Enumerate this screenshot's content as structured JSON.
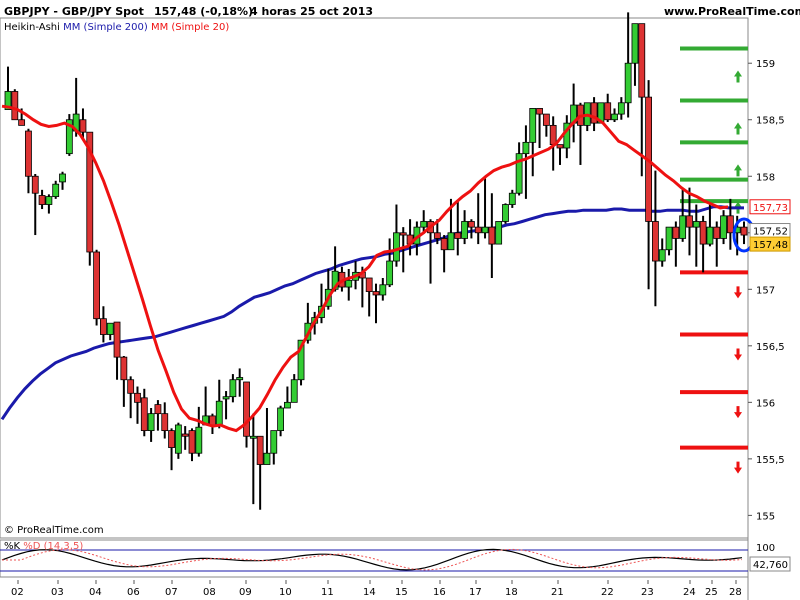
{
  "header": {
    "instrument": "GBPJPY - GBP/JPY Spot",
    "quote": "157,48 (-0,18%)",
    "period": "4 horas  25 oct 2013",
    "site": "www.ProRealTime.com"
  },
  "legend": {
    "chart_style": "Heikin-Ashi",
    "ma200": "MM (Simple 200)",
    "ma20": "MM (Simple 20)"
  },
  "watermark": "© ProRealTime.com",
  "price_labels": {
    "ma20_value": "157,73",
    "ma200_value": "157,52",
    "last_price": "157,48"
  },
  "stoch": {
    "label_k": "%K",
    "label_d": "%D (14,3,5)",
    "level_high": "100",
    "level_value": "42,760"
  },
  "colors": {
    "bull": "#33cc33",
    "bear": "#dd3333",
    "ma20": "#ee1111",
    "ma200": "#1a1aaa",
    "resistance": "#33aa33",
    "support": "#ee1111",
    "label_gold": "#ffcc33"
  },
  "chart_data": {
    "type": "candlestick",
    "title": "GBPJPY - GBP/JPY Spot",
    "ylim": [
      154.8,
      159.4
    ],
    "y_ticks": [
      155,
      155.5,
      156,
      156.5,
      157,
      157.5,
      158,
      158.5,
      159
    ],
    "y_tick_labels": [
      "155",
      "155,5",
      "156",
      "156,5",
      "157",
      "157,5",
      "158",
      "158,5",
      "159"
    ],
    "x_day_labels": [
      "02",
      "03",
      "04",
      "06",
      "07",
      "08",
      "09",
      "10",
      "11",
      "14",
      "15",
      "16",
      "17",
      "18",
      "21",
      "22",
      "23",
      "24",
      "25",
      "28"
    ],
    "sma200": [
      155.85,
      155.95,
      156.04,
      156.12,
      156.19,
      156.25,
      156.3,
      156.35,
      156.38,
      156.41,
      156.43,
      156.45,
      156.48,
      156.5,
      156.52,
      156.53,
      156.54,
      156.55,
      156.56,
      156.57,
      156.58,
      156.6,
      156.62,
      156.64,
      156.66,
      156.68,
      156.7,
      156.72,
      156.74,
      156.76,
      156.8,
      156.85,
      156.89,
      156.93,
      156.95,
      156.97,
      157.0,
      157.03,
      157.05,
      157.08,
      157.11,
      157.14,
      157.16,
      157.18,
      157.21,
      157.23,
      157.25,
      157.27,
      157.28,
      157.29,
      157.31,
      157.32,
      157.34,
      157.36,
      157.38,
      157.4,
      157.42,
      157.44,
      157.46,
      157.49,
      157.5,
      157.51,
      157.52,
      157.53,
      157.54,
      157.55,
      157.57,
      157.58,
      157.6,
      157.62,
      157.64,
      157.66,
      157.67,
      157.68,
      157.69,
      157.69,
      157.7,
      157.7,
      157.7,
      157.7,
      157.71,
      157.71,
      157.7,
      157.7,
      157.7,
      157.69,
      157.69,
      157.7,
      157.7,
      157.7,
      157.69,
      157.69,
      157.71,
      157.73,
      157.73,
      157.72,
      157.72,
      157.72
    ],
    "sma20": [
      158.62,
      158.61,
      158.59,
      158.55,
      158.5,
      158.46,
      158.44,
      158.45,
      158.47,
      158.44,
      158.37,
      158.26,
      158.12,
      157.96,
      157.77,
      157.57,
      157.35,
      157.13,
      156.91,
      156.68,
      156.46,
      156.28,
      156.09,
      155.94,
      155.86,
      155.84,
      155.81,
      155.79,
      155.8,
      155.77,
      155.75,
      155.8,
      155.87,
      155.95,
      156.07,
      156.2,
      156.31,
      156.4,
      156.45,
      156.58,
      156.71,
      156.82,
      156.95,
      157.05,
      157.09,
      157.11,
      157.14,
      157.2,
      157.3,
      157.33,
      157.34,
      157.36,
      157.38,
      157.45,
      157.5,
      157.56,
      157.61,
      157.69,
      157.76,
      157.82,
      157.87,
      157.94,
      158.0,
      158.05,
      158.08,
      158.1,
      158.13,
      158.15,
      158.18,
      158.21,
      158.24,
      158.29,
      158.38,
      158.46,
      158.53,
      158.54,
      158.52,
      158.47,
      158.39,
      158.31,
      158.28,
      158.23,
      158.18,
      158.13,
      158.07,
      158.01,
      157.96,
      157.9,
      157.85,
      157.82,
      157.78,
      157.75,
      157.72,
      157.73
    ],
    "resistance_levels": [
      159.13,
      158.67,
      158.3,
      157.97,
      157.78
    ],
    "support_levels": [
      157.15,
      156.6,
      156.09,
      155.6
    ],
    "candles": [
      [
        158.59,
        158.75,
        158.6,
        158.97
      ],
      [
        158.75,
        158.5,
        158.62,
        158.77
      ],
      [
        158.5,
        158.45,
        158.6,
        158.48
      ],
      [
        158.4,
        158.0,
        158.42,
        157.85
      ],
      [
        158.0,
        157.85,
        158.02,
        157.48
      ],
      [
        157.83,
        157.75,
        157.88,
        157.71
      ],
      [
        157.75,
        157.82,
        157.84,
        157.67
      ],
      [
        157.82,
        157.93,
        157.96,
        157.8
      ],
      [
        157.95,
        158.02,
        158.04,
        157.88
      ],
      [
        158.2,
        158.5,
        158.55,
        158.18
      ],
      [
        158.4,
        158.55,
        158.87,
        158.35
      ],
      [
        158.5,
        158.39,
        158.6,
        158.33
      ],
      [
        158.39,
        157.33,
        158.38,
        157.21
      ],
      [
        157.33,
        156.74,
        157.35,
        156.68
      ],
      [
        156.74,
        156.6,
        156.85,
        156.53
      ],
      [
        156.6,
        156.7,
        156.7,
        156.55
      ],
      [
        156.71,
        156.4,
        156.71,
        156.2
      ],
      [
        156.4,
        156.2,
        156.41,
        155.96
      ],
      [
        156.2,
        156.08,
        156.23,
        155.86
      ],
      [
        156.08,
        156.0,
        156.14,
        155.81
      ],
      [
        156.04,
        155.75,
        156.12,
        155.7
      ],
      [
        155.75,
        155.9,
        155.95,
        155.65
      ],
      [
        155.98,
        155.9,
        156.02,
        155.75
      ],
      [
        155.9,
        155.75,
        156.0,
        155.68
      ],
      [
        155.75,
        155.6,
        155.77,
        155.4
      ],
      [
        155.55,
        155.8,
        155.82,
        155.5
      ],
      [
        155.72,
        155.7,
        155.79,
        155.58
      ],
      [
        155.75,
        155.55,
        155.77,
        155.48
      ],
      [
        155.55,
        155.78,
        155.96,
        155.52
      ],
      [
        155.8,
        155.88,
        156.14,
        155.82
      ],
      [
        155.88,
        155.8,
        155.9,
        155.72
      ],
      [
        155.8,
        156.01,
        156.2,
        155.77
      ],
      [
        156.03,
        156.05,
        156.1,
        155.85
      ],
      [
        156.05,
        156.2,
        156.25,
        156.0
      ],
      [
        156.2,
        156.22,
        156.3,
        156.05
      ],
      [
        156.18,
        155.7,
        156.16,
        155.6
      ],
      [
        155.7,
        155.7,
        155.9,
        155.1
      ],
      [
        155.7,
        155.45,
        155.6,
        155.05
      ],
      [
        155.45,
        155.55,
        155.95,
        155.53
      ],
      [
        155.55,
        155.75,
        155.72,
        155.45
      ],
      [
        155.75,
        155.95,
        155.97,
        155.7
      ],
      [
        155.95,
        156.0,
        156.14,
        155.95
      ],
      [
        156.0,
        156.2,
        156.25,
        156.04
      ],
      [
        156.2,
        156.55,
        156.47,
        156.15
      ],
      [
        156.55,
        156.7,
        156.88,
        156.52
      ],
      [
        156.7,
        156.75,
        156.8,
        156.6
      ],
      [
        156.75,
        156.85,
        157.05,
        156.7
      ],
      [
        156.85,
        157.0,
        157.18,
        156.82
      ],
      [
        157.0,
        157.16,
        157.38,
        156.98
      ],
      [
        157.15,
        157.02,
        157.2,
        156.98
      ],
      [
        157.02,
        157.08,
        157.18,
        156.9
      ],
      [
        157.08,
        157.15,
        157.25,
        157.0
      ],
      [
        157.15,
        157.1,
        157.2,
        156.84
      ],
      [
        157.1,
        156.98,
        157.1,
        156.76
      ],
      [
        156.98,
        156.95,
        157.05,
        156.7
      ],
      [
        156.95,
        157.04,
        157.1,
        156.9
      ],
      [
        157.04,
        157.25,
        157.45,
        157.02
      ],
      [
        157.25,
        157.5,
        157.75,
        157.2
      ],
      [
        157.5,
        157.48,
        157.55,
        157.15
      ],
      [
        157.48,
        157.4,
        157.62,
        157.3
      ],
      [
        157.4,
        157.55,
        157.6,
        157.3
      ],
      [
        157.55,
        157.6,
        157.7,
        157.49
      ],
      [
        157.6,
        157.5,
        157.62,
        157.05
      ],
      [
        157.5,
        157.45,
        157.62,
        157.4
      ],
      [
        157.45,
        157.35,
        157.48,
        157.15
      ],
      [
        157.35,
        157.5,
        157.8,
        157.35
      ],
      [
        157.5,
        157.45,
        157.78,
        157.3
      ],
      [
        157.45,
        157.6,
        157.7,
        157.4
      ],
      [
        157.6,
        157.55,
        157.62,
        157.45
      ],
      [
        157.55,
        157.5,
        157.85,
        157.4
      ],
      [
        157.5,
        157.55,
        157.98,
        157.45
      ],
      [
        157.55,
        157.4,
        157.85,
        157.1
      ],
      [
        157.4,
        157.6,
        157.55,
        157.45
      ],
      [
        157.6,
        157.75,
        157.76,
        157.58
      ],
      [
        157.75,
        157.85,
        157.88,
        157.72
      ],
      [
        157.85,
        158.2,
        158.3,
        157.83
      ],
      [
        158.2,
        158.3,
        158.45,
        157.8
      ],
      [
        158.3,
        158.6,
        158.6,
        158.0
      ],
      [
        158.6,
        158.55,
        158.6,
        158.25
      ],
      [
        158.55,
        158.45,
        158.47,
        158.35
      ],
      [
        158.45,
        158.28,
        158.53,
        158.05
      ],
      [
        158.28,
        158.25,
        158.27,
        158.1
      ],
      [
        158.25,
        158.47,
        158.54,
        158.16
      ],
      [
        158.47,
        158.63,
        158.82,
        158.3
      ],
      [
        158.63,
        158.45,
        158.65,
        158.1
      ],
      [
        158.45,
        158.65,
        158.62,
        158.4
      ],
      [
        158.65,
        158.47,
        158.7,
        158.4
      ],
      [
        158.47,
        158.65,
        158.64,
        158.48
      ],
      [
        158.65,
        158.5,
        158.73,
        158.48
      ],
      [
        158.5,
        158.55,
        158.6,
        158.48
      ],
      [
        158.55,
        158.65,
        158.7,
        158.5
      ],
      [
        158.65,
        159.0,
        159.45,
        158.52
      ],
      [
        159.0,
        159.35,
        159.3,
        158.8
      ],
      [
        159.35,
        158.7,
        159.35,
        158.0
      ],
      [
        158.7,
        157.6,
        158.85,
        157.0
      ],
      [
        157.6,
        157.25,
        158.05,
        156.85
      ],
      [
        157.25,
        157.35,
        157.45,
        157.2
      ],
      [
        157.35,
        157.55,
        157.55,
        157.3
      ],
      [
        157.55,
        157.45,
        157.6,
        157.2
      ],
      [
        157.45,
        157.65,
        157.9,
        157.42
      ],
      [
        157.65,
        157.55,
        157.9,
        157.3
      ],
      [
        157.55,
        157.6,
        157.75,
        157.2
      ],
      [
        157.6,
        157.4,
        157.65,
        157.15
      ],
      [
        157.4,
        157.55,
        157.75,
        157.38
      ],
      [
        157.55,
        157.45,
        157.6,
        157.2
      ],
      [
        157.45,
        157.65,
        157.7,
        157.4
      ],
      [
        157.65,
        157.5,
        157.8,
        157.35
      ],
      [
        157.5,
        157.55,
        157.65,
        157.3
      ],
      [
        157.55,
        157.48,
        157.6,
        157.4
      ]
    ]
  }
}
